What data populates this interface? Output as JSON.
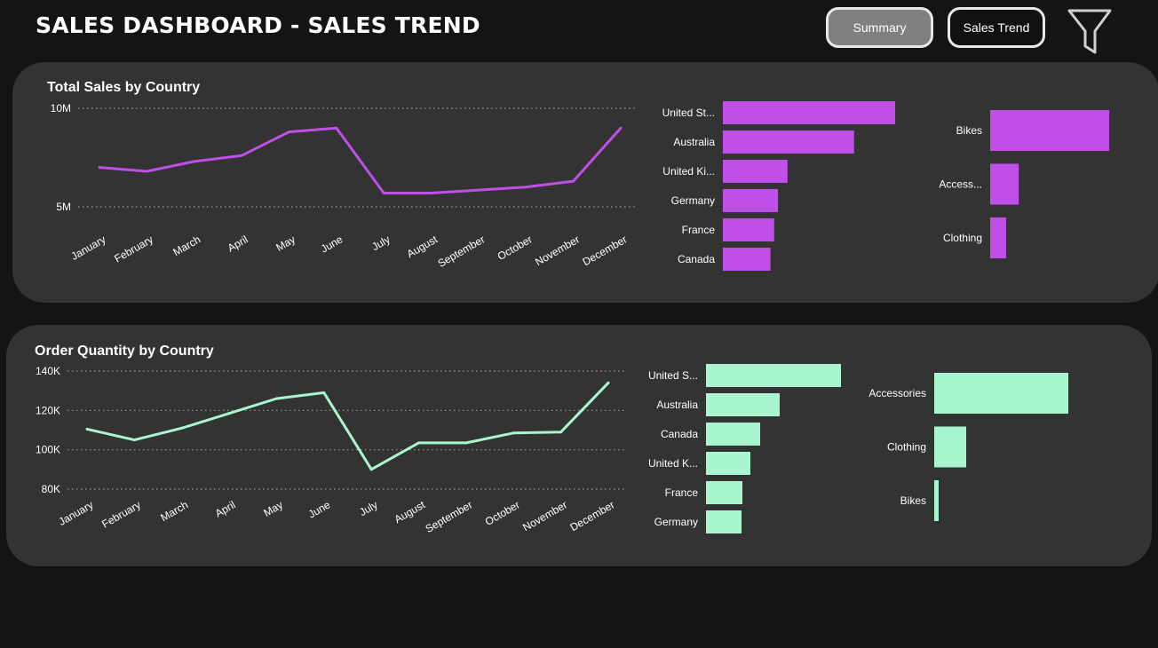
{
  "header": {
    "title": "SALES DASHBOARD - SALES TREND",
    "summary_label": "Summary",
    "trend_label": "Sales Trend",
    "filter_icon": "funnel-icon"
  },
  "colors": {
    "sales": "#c04ee8",
    "quantity": "#a8f5cf",
    "panel": "#333333",
    "background": "#141414"
  },
  "chart_data": [
    {
      "type": "line",
      "title": "Total Sales by Country",
      "categories": [
        "January",
        "February",
        "March",
        "April",
        "May",
        "June",
        "July",
        "August",
        "September",
        "October",
        "November",
        "December"
      ],
      "values": [
        7.0,
        6.8,
        7.3,
        7.6,
        8.8,
        9.0,
        5.7,
        5.7,
        5.85,
        6.0,
        6.3,
        9.0
      ],
      "yticks": [
        "10M",
        "5M"
      ],
      "ytick_values": [
        10,
        5
      ],
      "ylim": [
        5,
        10
      ],
      "grid": true
    },
    {
      "type": "bar",
      "orientation": "horizontal",
      "categories": [
        "United St...",
        "Australia",
        "United Ki...",
        "Germany",
        "France",
        "Canada"
      ],
      "values": [
        9.06,
        6.9,
        3.4,
        2.9,
        2.7,
        2.5
      ]
    },
    {
      "type": "bar",
      "orientation": "horizontal",
      "categories": [
        "Bikes",
        "Access...",
        "Clothing"
      ],
      "values": [
        28.3,
        6.8,
        3.8
      ]
    },
    {
      "type": "line",
      "title": "Order Quantity by Country",
      "categories": [
        "January",
        "February",
        "March",
        "April",
        "May",
        "June",
        "July",
        "August",
        "September",
        "October",
        "November",
        "December"
      ],
      "values": [
        110500,
        105000,
        111000,
        118500,
        126000,
        129000,
        90000,
        103500,
        103500,
        108500,
        109000,
        134000
      ],
      "yticks": [
        "140K",
        "120K",
        "100K",
        "80K"
      ],
      "ytick_values": [
        140000,
        120000,
        100000,
        80000
      ],
      "ylim": [
        80000,
        140000
      ],
      "grid": true
    },
    {
      "type": "bar",
      "orientation": "horizontal",
      "categories": [
        "United S...",
        "Australia",
        "Canada",
        "United K...",
        "France",
        "Germany"
      ],
      "values": [
        15.2,
        8.3,
        6.1,
        5.0,
        4.1,
        4.0
      ]
    },
    {
      "type": "bar",
      "orientation": "horizontal",
      "categories": [
        "Accessories",
        "Clothing",
        "Bikes"
      ],
      "values": [
        15.1,
        3.6,
        0.5
      ]
    }
  ]
}
